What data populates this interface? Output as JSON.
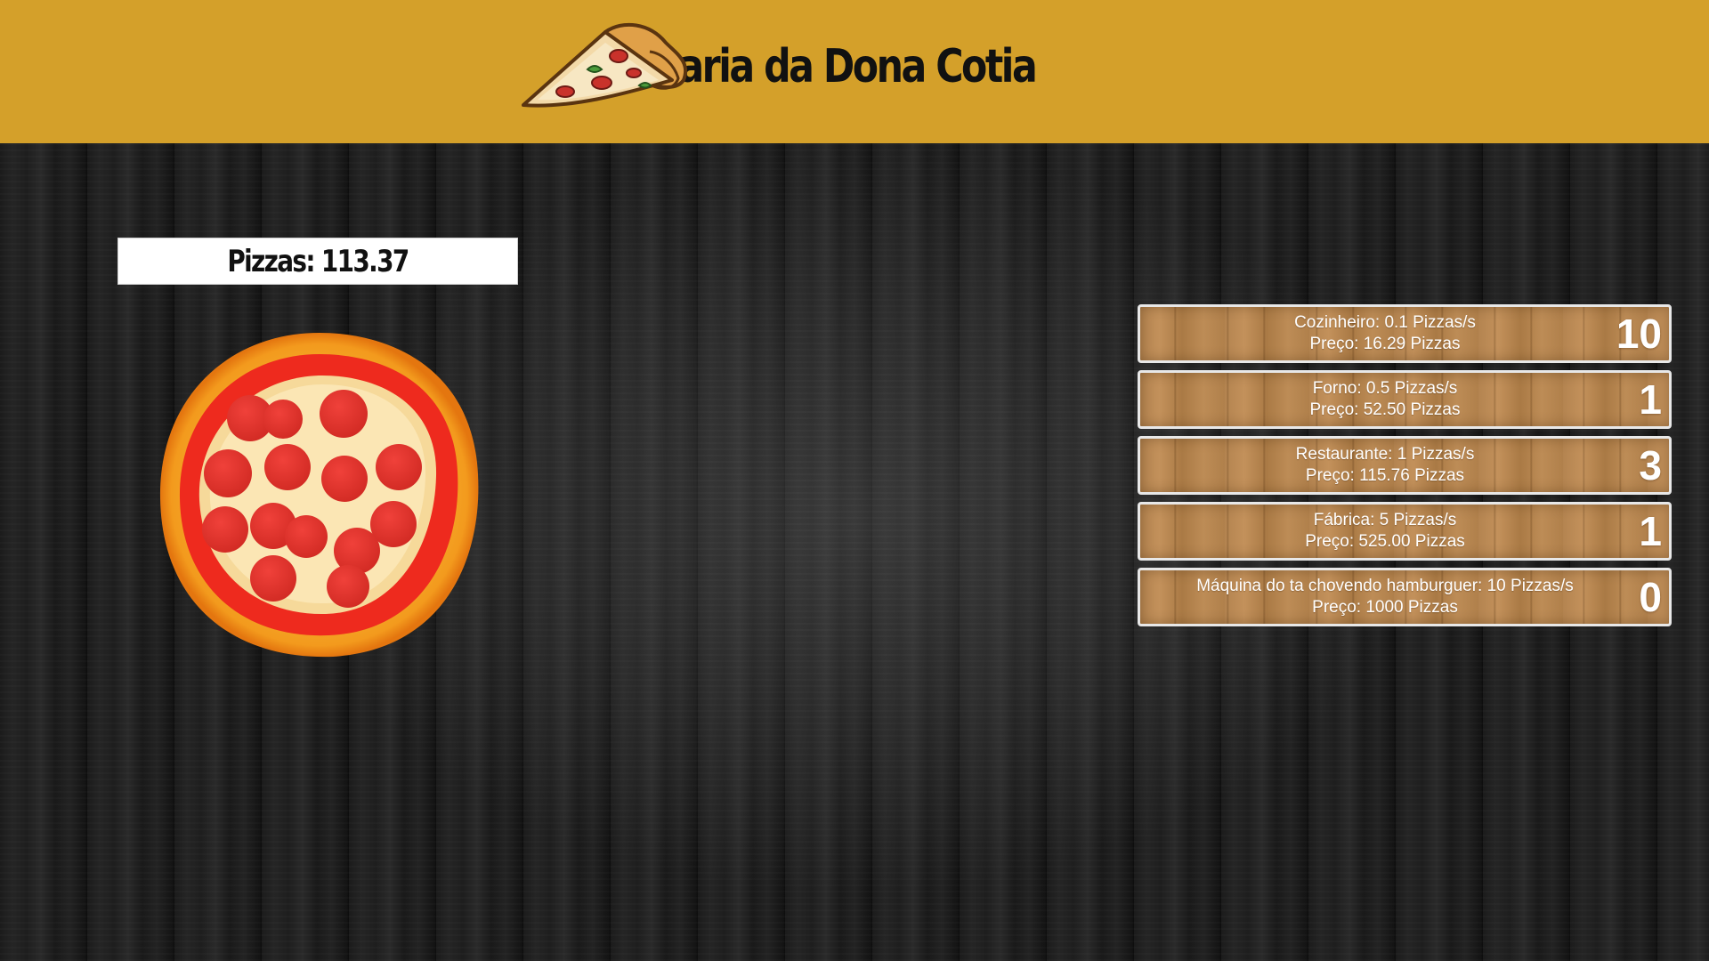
{
  "header": {
    "title": "Pizzaria da Dona Cotia",
    "title_visible": "zaria da Dona Cotia",
    "logo_icon": "pizza-slice-icon",
    "background_color": "#d4a02a"
  },
  "counter": {
    "text": "Pizzas: 113.37"
  },
  "pizza": {
    "icon": "pepperoni-pizza-icon"
  },
  "shop": {
    "items": [
      {
        "line1": "Cozinheiro: 0.1 Pizzas/s",
        "line2": "Preço: 16.29 Pizzas",
        "count": "10"
      },
      {
        "line1": "Forno: 0.5 Pizzas/s",
        "line2": "Preço: 52.50 Pizzas",
        "count": "1"
      },
      {
        "line1": "Restaurante: 1 Pizzas/s",
        "line2": "Preço: 115.76 Pizzas",
        "count": "3"
      },
      {
        "line1": "Fábrica: 5 Pizzas/s",
        "line2": "Preço: 525.00 Pizzas",
        "count": "1"
      },
      {
        "line1": "Máquina do ta chovendo hamburguer: 10 Pizzas/s",
        "line2": "Preço: 1000 Pizzas",
        "count": "0"
      }
    ]
  }
}
